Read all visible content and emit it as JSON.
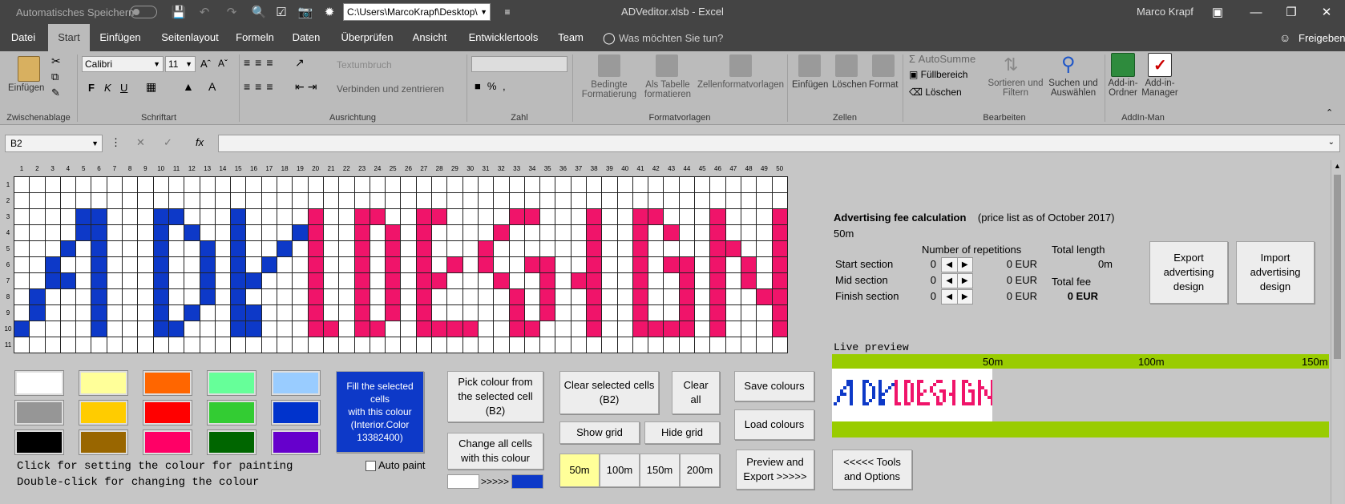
{
  "titlebar": {
    "autosave_label": "Automatisches Speichern",
    "path": "C:\\Users\\MarcoKrapf\\Desktop\\",
    "title": "ADVeditor.xlsb  -  Excel",
    "user": "Marco Krapf"
  },
  "tabs": [
    "Datei",
    "Start",
    "Einfügen",
    "Seitenlayout",
    "Formeln",
    "Daten",
    "Überprüfen",
    "Ansicht",
    "Entwicklertools",
    "Team"
  ],
  "tellme": "Was möchten Sie tun?",
  "share": "Freigeben",
  "ribbon": {
    "clipboard": {
      "paste": "Einfügen",
      "group": "Zwischenablage"
    },
    "font": {
      "name": "Calibri",
      "size": "11",
      "bold": "F",
      "italic": "K",
      "underline": "U",
      "group": "Schriftart"
    },
    "alignment": {
      "wrap": "Textumbruch",
      "merge": "Verbinden und zentrieren",
      "group": "Ausrichtung"
    },
    "number": {
      "group": "Zahl"
    },
    "styles": {
      "cond": "Bedingte\nFormatierung",
      "table": "Als Tabelle\nformatieren",
      "cell": "Zellenformatvorlagen",
      "group": "Formatvorlagen"
    },
    "cells": {
      "insert": "Einfügen",
      "delete": "Löschen",
      "format": "Format",
      "group": "Zellen"
    },
    "editing": {
      "autosum": "AutoSumme",
      "fill": "Füllbereich",
      "clear": "Löschen",
      "sort": "Sortieren und\nFiltern",
      "find": "Suchen und\nAuswählen",
      "group": "Bearbeiten"
    },
    "addin": {
      "folder": "Add-in-\nOrdner",
      "manager": "Add-in-\nManager",
      "group": "AddIn-Man"
    }
  },
  "formula": {
    "namebox": "B2",
    "fx": "fx"
  },
  "grid": {
    "rows": 11,
    "cols": 50,
    "blue": "#0d39c8",
    "pink": "#f0146a",
    "cells": [
      "..................................................",
      "..................................................",
      "....##...##...#....#..##..##....##...#..##...#...#",
      "....##...#.#..#...##..#.#.#....#.....#..#.#..#...#",
      "...#.#...#..#.#..#.#..#.#.#...#......#..#....##..#",
      "..#..#...#..#.#.#..#..#.#.#.#.#..##..#..#.##.#.#.#",
      "..##.#...#..#.##...#..#.#.##...#..#.##..#..#.#.#.#",
      ".#...#...#..#.#....#..#.#.#.....#.#..#..#..#.#..##",
      ".#...#...#.#..##...#..#.#.#.....#.#..#..#..#.#...#",
      "#....#...##...##...##.##..####..##...#..####.#...#",
      ".................................................."
    ]
  },
  "palette": {
    "colors": [
      "#ffffff",
      "#ffff99",
      "#ff6600",
      "#66ff99",
      "#99ccff",
      "#969696",
      "#ffcc00",
      "#ff0000",
      "#33cc33",
      "#0033cc",
      "#000000",
      "#996600",
      "#ff0066",
      "#006600",
      "#6600cc"
    ],
    "hint1": "Click for setting the colour for painting",
    "hint2": "Double-click for changing the colour",
    "autopaint": "Auto paint"
  },
  "buttons": {
    "fill_cells": "Fill the selected\ncells\nwith this colour\n(Interior.Color\n13382400)",
    "pick_colour": "Pick colour from\nthe selected cell\n(B2)",
    "change_all": "Change all cells\nwith this colour",
    "arrow": ">>>>>",
    "clear_selected": "Clear selected cells\n(B2)",
    "clear_all": "Clear\nall",
    "show_grid": "Show grid",
    "hide_grid": "Hide grid",
    "len50": "50m",
    "len100": "100m",
    "len150": "150m",
    "len200": "200m",
    "save_colours": "Save colours",
    "load_colours": "Load colours",
    "preview_export": "Preview and\nExport >>>>>",
    "tools": "<<<<< Tools\nand Options",
    "export_design": "Export\nadvertising\ndesign",
    "import_design": "Import\nadvertising\ndesign"
  },
  "calc": {
    "title": "Advertising fee calculation",
    "price_note": "(price list as of October 2017)",
    "length": "50m",
    "col_reps": "Number of repetitions",
    "col_total": "Total length",
    "rows": [
      {
        "label": "Start section",
        "reps": "0",
        "fee": "0 EUR"
      },
      {
        "label": "Mid section",
        "reps": "0",
        "fee": "0 EUR"
      },
      {
        "label": "Finish section",
        "reps": "0",
        "fee": "0 EUR"
      }
    ],
    "total_length": "0m",
    "total_fee_label": "Total fee",
    "total_fee": "0 EUR"
  },
  "preview": {
    "label": "Live preview",
    "m50": "50m",
    "m100": "100m",
    "m150": "150m",
    "bar_color": "#99cc00",
    "text_adv": "ADV",
    "text_design": "DESiGN"
  }
}
